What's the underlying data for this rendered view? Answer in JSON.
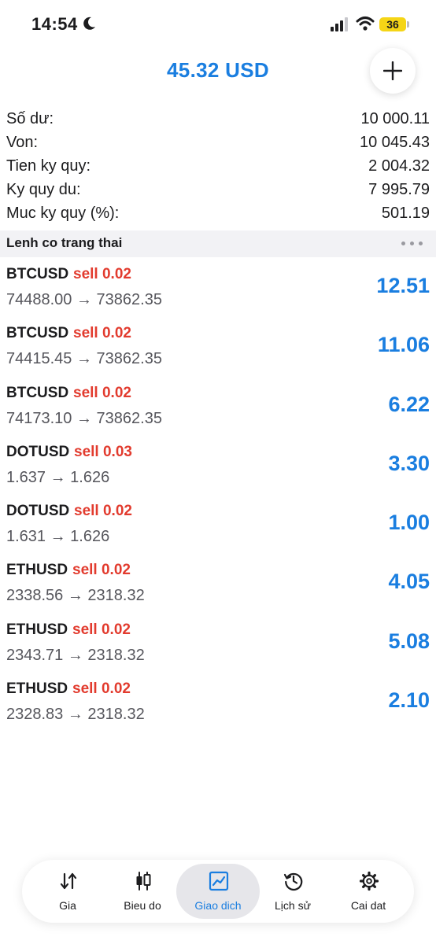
{
  "status_bar": {
    "time": "14:54",
    "battery": "36"
  },
  "header": {
    "equity": "45.32 USD",
    "add_icon": "plus-icon"
  },
  "summary": [
    {
      "label": "Số dư:",
      "value": "10 000.11"
    },
    {
      "label": "Von:",
      "value": "10 045.43"
    },
    {
      "label": "Tien ky quy:",
      "value": "2 004.32"
    },
    {
      "label": "Ky quy du:",
      "value": "7 995.79"
    },
    {
      "label": "Muc ky quy (%):",
      "value": "501.19"
    }
  ],
  "section": {
    "title": "Lenh co trang thai",
    "more_icon": "more-dots-icon"
  },
  "positions": [
    {
      "symbol": "BTCUSD",
      "side": "sell 0.02",
      "prices": "74488.00 → 73862.35",
      "profit": "12.51"
    },
    {
      "symbol": "BTCUSD",
      "side": "sell 0.02",
      "prices": "74415.45 → 73862.35",
      "profit": "11.06"
    },
    {
      "symbol": "BTCUSD",
      "side": "sell 0.02",
      "prices": "74173.10 → 73862.35",
      "profit": "6.22"
    },
    {
      "symbol": "DOTUSD",
      "side": "sell 0.03",
      "prices": "1.637 → 1.626",
      "profit": "3.30"
    },
    {
      "symbol": "DOTUSD",
      "side": "sell 0.02",
      "prices": "1.631 → 1.626",
      "profit": "1.00"
    },
    {
      "symbol": "ETHUSD",
      "side": "sell 0.02",
      "prices": "2338.56 → 2318.32",
      "profit": "4.05"
    },
    {
      "symbol": "ETHUSD",
      "side": "sell 0.02",
      "prices": "2343.71 → 2318.32",
      "profit": "5.08"
    },
    {
      "symbol": "ETHUSD",
      "side": "sell 0.02",
      "prices": "2328.83 → 2318.32",
      "profit": "2.10"
    }
  ],
  "nav": {
    "items": [
      {
        "label": "Gia",
        "icon": "quotes-arrows-icon"
      },
      {
        "label": "Bieu do",
        "icon": "candlestick-icon"
      },
      {
        "label": "Giao dich",
        "icon": "trade-chart-icon",
        "active": true
      },
      {
        "label": "Lịch sử",
        "icon": "history-clock-icon"
      },
      {
        "label": "Cai dat",
        "icon": "gear-icon"
      }
    ]
  },
  "colors": {
    "accent": "#1a7ee0",
    "sell": "#e23b2e",
    "battery": "#f5d516"
  }
}
